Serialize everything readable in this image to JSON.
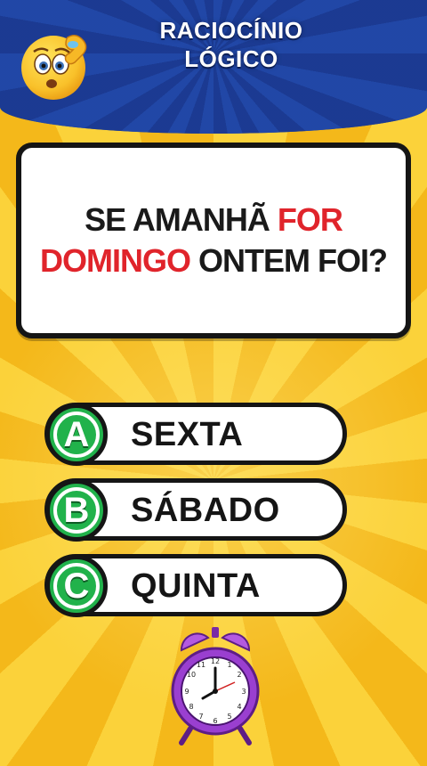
{
  "header": {
    "title_line1": "RACIOCÍNIO",
    "title_line2": "LÓGICO",
    "emoji_icon": "confused-face-icon",
    "background_color": "#1f3f9a"
  },
  "question": {
    "part1": "SE AMANHÃ ",
    "part2_highlight": "FOR",
    "part3_highlight": "DOMINGO",
    "part4": " ONTEM FOI?",
    "highlight_color": "#e0242b"
  },
  "answers": [
    {
      "letter": "A",
      "label": "SEXTA"
    },
    {
      "letter": "B",
      "label": "SÁBADO"
    },
    {
      "letter": "C",
      "label": "QUINTA"
    }
  ],
  "badge_color": "#21b24b",
  "footer": {
    "clock_icon": "alarm-clock-icon",
    "clock_color": "#9a3fd0"
  }
}
